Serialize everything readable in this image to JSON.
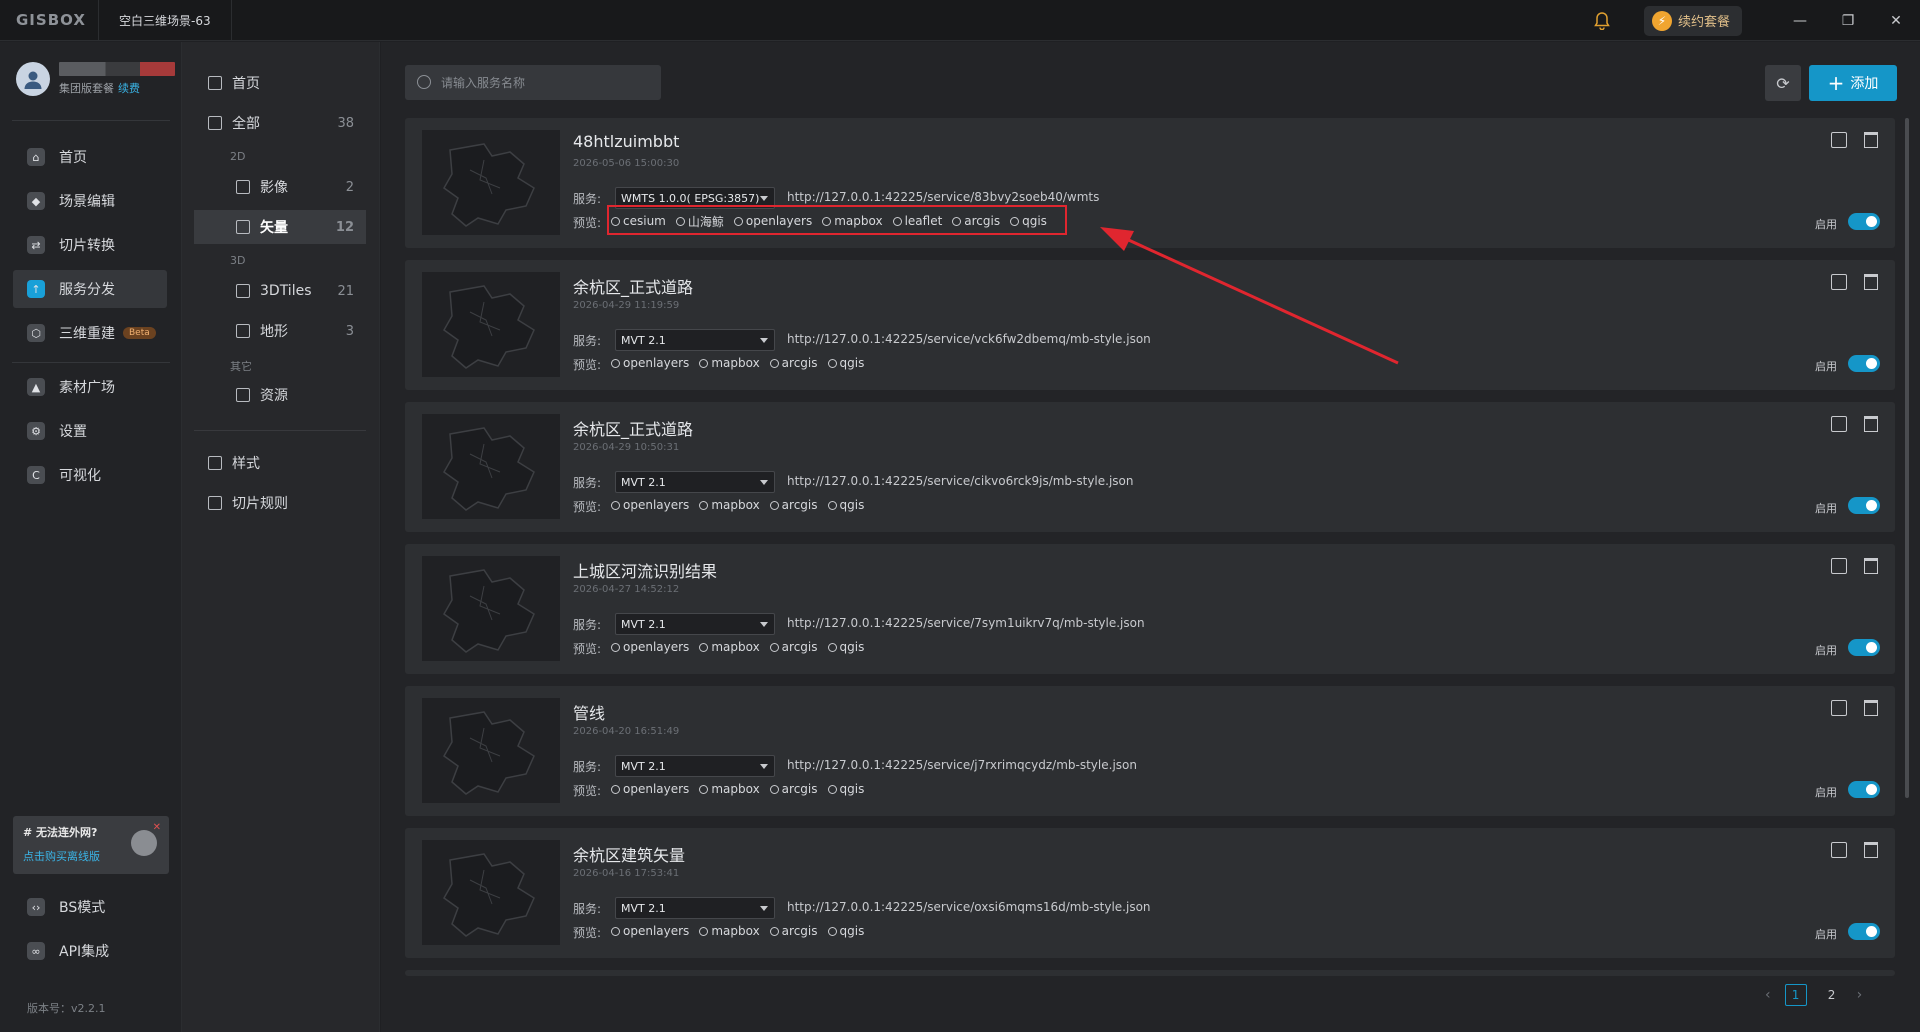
{
  "app": {
    "logo": "GISBOX",
    "tab_title": "空白三维场景-63",
    "renew_label": "续约套餐",
    "window": {
      "min": "—",
      "max": "❐",
      "close": "✕"
    }
  },
  "user": {
    "plan": "集团版套餐",
    "renew": "续费"
  },
  "sidebar": {
    "items": [
      {
        "label": "首页",
        "icon": "home-icon"
      },
      {
        "label": "场景编辑",
        "icon": "cube-icon"
      },
      {
        "label": "切片转换",
        "icon": "convert-icon"
      },
      {
        "label": "服务分发",
        "icon": "upload-icon"
      },
      {
        "label": "三维重建",
        "icon": "rebuild-icon",
        "badge": "Beta"
      },
      {
        "label": "素材广场",
        "icon": "image-icon"
      },
      {
        "label": "设置",
        "icon": "gear-icon"
      },
      {
        "label": "可视化",
        "icon": "visual-icon"
      }
    ],
    "bottom_items": [
      {
        "label": "BS模式",
        "icon": "code-icon"
      },
      {
        "label": "API集成",
        "icon": "link-icon"
      }
    ],
    "offline": {
      "title": "# 无法连外网?",
      "link": "点击购买离线版"
    },
    "version": "版本号：v2.2.1"
  },
  "subnav": {
    "home": "首页",
    "all": {
      "label": "全部",
      "count": "38"
    },
    "group_2d": "2D",
    "imagery": {
      "label": "影像",
      "count": "2"
    },
    "vector": {
      "label": "矢量",
      "count": "12"
    },
    "group_3d": "3D",
    "tiles3d": {
      "label": "3DTiles",
      "count": "21"
    },
    "terrain": {
      "label": "地形",
      "count": "3"
    },
    "group_other": "其它",
    "resource": "资源",
    "style": "样式",
    "tile_rule": "切片规则"
  },
  "toolbar": {
    "search_placeholder": "请输入服务名称",
    "add_label": "添加"
  },
  "labels": {
    "service": "服务:",
    "preview": "预览:",
    "enable": "启用"
  },
  "cards": [
    {
      "title": "48htlzuimbbt",
      "date": "2026-05-06 15:00:30",
      "service": "WMTS 1.0.0( EPSG:3857)",
      "url": "http://127.0.0.1:42225/service/83bvy2soeb40/wmts",
      "previews": [
        "cesium",
        "山海鲸",
        "openlayers",
        "mapbox",
        "leaflet",
        "arcgis",
        "qgis"
      ]
    },
    {
      "title": "余杭区_正式道路",
      "date": "2026-04-29 11:19:59",
      "service": "MVT 2.1",
      "url": "http://127.0.0.1:42225/service/vck6fw2dbemq/mb-style.json",
      "previews": [
        "openlayers",
        "mapbox",
        "arcgis",
        "qgis"
      ]
    },
    {
      "title": "余杭区_正式道路",
      "date": "2026-04-29 10:50:31",
      "service": "MVT 2.1",
      "url": "http://127.0.0.1:42225/service/cikvo6rck9js/mb-style.json",
      "previews": [
        "openlayers",
        "mapbox",
        "arcgis",
        "qgis"
      ]
    },
    {
      "title": "上城区河流识别结果",
      "date": "2026-04-27 14:52:12",
      "service": "MVT 2.1",
      "url": "http://127.0.0.1:42225/service/7sym1uikrv7q/mb-style.json",
      "previews": [
        "openlayers",
        "mapbox",
        "arcgis",
        "qgis"
      ]
    },
    {
      "title": "管线",
      "date": "2026-04-20 16:51:49",
      "service": "MVT 2.1",
      "url": "http://127.0.0.1:42225/service/j7rxrimqcydz/mb-style.json",
      "previews": [
        "openlayers",
        "mapbox",
        "arcgis",
        "qgis"
      ]
    },
    {
      "title": "余杭区建筑矢量",
      "date": "2026-04-16 17:53:41",
      "service": "MVT 2.1",
      "url": "http://127.0.0.1:42225/service/oxsi6mqms16d/mb-style.json",
      "previews": [
        "openlayers",
        "mapbox",
        "arcgis",
        "qgis"
      ]
    }
  ],
  "pagination": {
    "prev": "‹",
    "pages": [
      "1",
      "2"
    ],
    "next": "›",
    "current": "1"
  },
  "colors": {
    "accent": "#1596c8",
    "highlight": "#e0262f"
  }
}
